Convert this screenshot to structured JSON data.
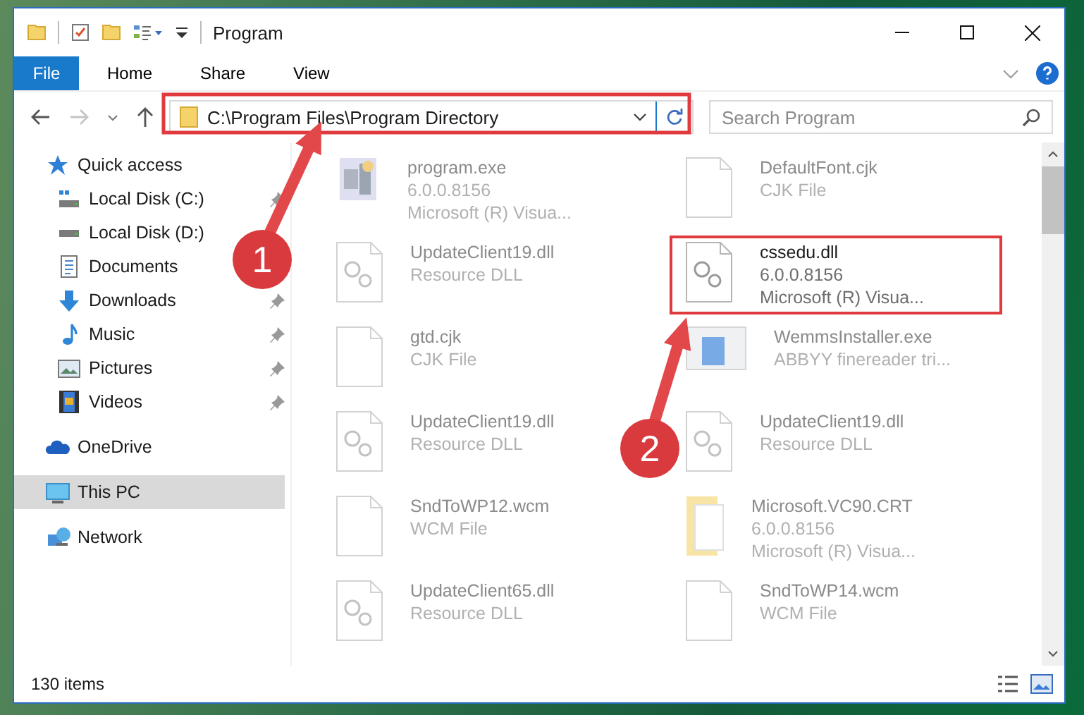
{
  "window": {
    "title": "Program"
  },
  "ribbon": {
    "file_tab": "File",
    "tabs": [
      "Home",
      "Share",
      "View"
    ]
  },
  "address_bar": {
    "path": "C:\\Program Files\\Program Directory",
    "highlighted": true
  },
  "search": {
    "placeholder": "Search Program"
  },
  "sidebar": {
    "items": [
      {
        "label": "Quick access",
        "kind": "star",
        "selected": false,
        "children": [
          {
            "label": "Local Disk (C:)",
            "kind": "drive-c",
            "pinned": true,
            "selected": false
          },
          {
            "label": "Local Disk (D:)",
            "kind": "drive",
            "pinned": false,
            "selected": false
          },
          {
            "label": "Documents",
            "kind": "documents",
            "pinned": false,
            "selected": false
          },
          {
            "label": "Downloads",
            "kind": "downloads",
            "pinned": true,
            "selected": false
          },
          {
            "label": "Music",
            "kind": "music",
            "pinned": true,
            "selected": false
          },
          {
            "label": "Pictures",
            "kind": "pictures",
            "pinned": true,
            "selected": false
          },
          {
            "label": "Videos",
            "kind": "videos",
            "pinned": true,
            "selected": false
          }
        ]
      },
      {
        "label": "OneDrive",
        "kind": "cloud",
        "selected": false
      },
      {
        "label": "This PC",
        "kind": "pc",
        "selected": true
      },
      {
        "label": "Network",
        "kind": "network",
        "selected": false
      }
    ]
  },
  "files": [
    {
      "name": "program.exe",
      "kind": "exe",
      "details": [
        "6.0.0.8156",
        "Microsoft (R) Visua..."
      ],
      "highlighted": false
    },
    {
      "name": "DefaultFont.cjk",
      "kind": "file",
      "details": [
        "CJK File"
      ],
      "highlighted": false
    },
    {
      "name": "UpdateClient19.dll",
      "kind": "dll",
      "details": [
        "Resource DLL"
      ],
      "highlighted": false
    },
    {
      "name": "cssedu.dll",
      "kind": "dll",
      "details": [
        "6.0.0.8156",
        "Microsoft (R) Visua..."
      ],
      "highlighted": true
    },
    {
      "name": "gtd.cjk",
      "kind": "file",
      "details": [
        "CJK File"
      ],
      "highlighted": false
    },
    {
      "name": "WemmsInstaller.exe",
      "kind": "installer",
      "details": [
        "ABBYY finereader tri..."
      ],
      "highlighted": false
    },
    {
      "name": "UpdateClient19.dll",
      "kind": "dll",
      "details": [
        "Resource DLL"
      ],
      "highlighted": false
    },
    {
      "name": "UpdateClient19.dll",
      "kind": "dll",
      "details": [
        "Resource DLL"
      ],
      "highlighted": false
    },
    {
      "name": "SndToWP12.wcm",
      "kind": "file",
      "details": [
        "WCM File"
      ],
      "highlighted": false
    },
    {
      "name": "Microsoft.VC90.CRT",
      "kind": "folder",
      "details": [
        "6.0.0.8156",
        "Microsoft (R) Visua..."
      ],
      "highlighted": false
    },
    {
      "name": "UpdateClient65.dll",
      "kind": "dll",
      "details": [
        "Resource DLL"
      ],
      "highlighted": false
    },
    {
      "name": "SndToWP14.wcm",
      "kind": "file",
      "details": [
        "WCM File"
      ],
      "highlighted": false
    }
  ],
  "status_bar": {
    "count": "130 items"
  },
  "annotations": [
    {
      "label": "1"
    },
    {
      "label": "2"
    }
  ]
}
